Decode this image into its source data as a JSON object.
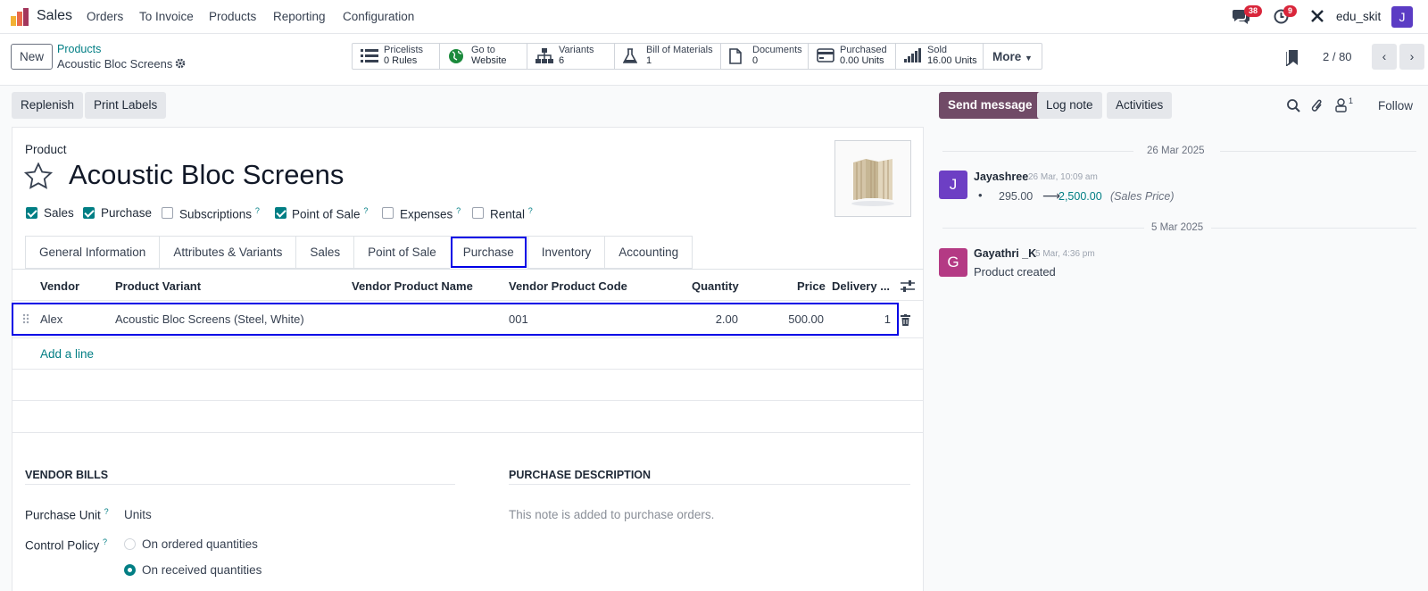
{
  "topbar": {
    "app_name": "Sales",
    "menus": [
      "Orders",
      "To Invoice",
      "Products",
      "Reporting",
      "Configuration"
    ],
    "messages_count": "38",
    "activities_count": "9",
    "company": "edu_skit",
    "user_initial": "J"
  },
  "control_panel": {
    "new_label": "New",
    "breadcrumb_parent": "Products",
    "breadcrumb_current": "Acoustic Bloc Screens",
    "smart_buttons": [
      {
        "label": "Pricelists",
        "value": "0 Rules"
      },
      {
        "label": "Go to",
        "value": "Website"
      },
      {
        "label": "Variants",
        "value": "6"
      },
      {
        "label": "Bill of Materials",
        "value": "1"
      },
      {
        "label": "Documents",
        "value": "0"
      },
      {
        "label": "Purchased",
        "value": "0.00 Units"
      },
      {
        "label": "Sold",
        "value": "16.00 Units"
      }
    ],
    "more_label": "More",
    "pager": "2 / 80"
  },
  "actions": {
    "replenish": "Replenish",
    "print_labels": "Print Labels"
  },
  "form": {
    "type_label": "Product",
    "name": "Acoustic Bloc Screens",
    "flags": [
      {
        "label": "Sales",
        "checked": true
      },
      {
        "label": "Purchase",
        "checked": true
      },
      {
        "label": "Subscriptions",
        "checked": false
      },
      {
        "label": "Point of Sale",
        "checked": true
      },
      {
        "label": "Expenses",
        "checked": false
      },
      {
        "label": "Rental",
        "checked": false
      }
    ],
    "tabs": [
      "General Information",
      "Attributes & Variants",
      "Sales",
      "Point of Sale",
      "Purchase",
      "Inventory",
      "Accounting"
    ],
    "active_tab": "Purchase",
    "table": {
      "headers": [
        "Vendor",
        "Product Variant",
        "Vendor Product Name",
        "Vendor Product Code",
        "Quantity",
        "Price",
        "Delivery ..."
      ],
      "rows": [
        {
          "vendor": "Alex",
          "variant": "Acoustic Bloc Screens (Steel, White)",
          "vendor_product_name": "",
          "code": "001",
          "quantity": "2.00",
          "price": "500.00",
          "delivery": "1"
        }
      ],
      "add_line": "Add a line"
    },
    "vendor_bills": {
      "title": "VENDOR BILLS",
      "purchase_unit_label": "Purchase Unit",
      "purchase_unit_value": "Units",
      "control_policy_label": "Control Policy",
      "options": [
        "On ordered quantities",
        "On received quantities"
      ],
      "selected": "On received quantities"
    },
    "purchase_description": {
      "title": "PURCHASE DESCRIPTION",
      "placeholder": "This note is added to purchase orders."
    }
  },
  "chatter": {
    "send_message": "Send message",
    "log_note": "Log note",
    "activities": "Activities",
    "followers_count": "1",
    "follow": "Follow",
    "dates": [
      "26 Mar 2025",
      "5 Mar 2025"
    ],
    "messages": [
      {
        "author": "Jayashree",
        "initial": "J",
        "time": "26 Mar, 10:09 am",
        "old_value": "295.00",
        "new_value": "2,500.00",
        "field": "(Sales Price)",
        "color": "#6d3fc4"
      },
      {
        "author": "Gayathri _K",
        "initial": "G",
        "time": "5 Mar, 4:36 pm",
        "body": "Product created",
        "color": "#b43a84"
      }
    ]
  },
  "colors": {
    "brand": "#714b67",
    "teal": "#017e84",
    "highlight": "#0000e6"
  }
}
